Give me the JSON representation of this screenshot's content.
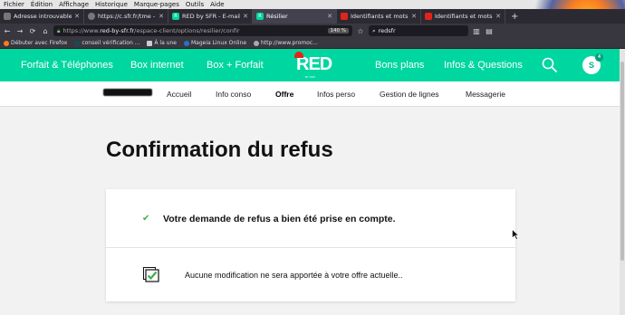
{
  "menubar": [
    "Fichier",
    "Édition",
    "Affichage",
    "Historique",
    "Marque-pages",
    "Outils",
    "Aide"
  ],
  "tabs": [
    {
      "title": "Adresse introuvable",
      "favicon_color": "#777777",
      "active": false
    },
    {
      "title": "https://c.sfr.fr/tme - Red",
      "favicon_color": "#777777",
      "active": false
    },
    {
      "title": "RED by SFR - E-mail",
      "favicon_color": "#00d6a0",
      "active": false
    },
    {
      "title": "Résilier",
      "favicon_color": "#00d6a0",
      "active": true
    },
    {
      "title": "Identifiants et mots de p",
      "favicon_color": "#e2231a",
      "active": false
    },
    {
      "title": "Identifiants et mots de p",
      "favicon_color": "#e2231a",
      "active": false
    }
  ],
  "navbar": {
    "url_prefix": "https://www.",
    "url_domain": "red-by-sfr.fr",
    "url_path": "/espace-client/options/resilier/confir",
    "zoom": "140 %",
    "search_value": "redsfr"
  },
  "bookmarks": [
    "Débuter avec Firefox",
    "conseil vérification ...",
    "À la une",
    "Mageia Linux Online",
    "http://www.promoc..."
  ],
  "site": {
    "nav_left": [
      "Forfait & Téléphones",
      "Box internet",
      "Box + Forfait"
    ],
    "logo": "RED",
    "logo_tag": "BY SFR",
    "nav_right": [
      "Bons plans",
      "Infos & Questions"
    ],
    "avatar_initial": "S",
    "avatar_badge": "4",
    "brand_color": "#00d6a0"
  },
  "subnav": {
    "items": [
      "Accueil",
      "Info conso",
      "Offre",
      "Infos perso",
      "Gestion de lignes",
      "Messagerie"
    ],
    "active": "Offre"
  },
  "main": {
    "title": "Confirmation du refus",
    "confirmation": "Votre demande de refus a bien été prise en compte.",
    "info": "Aucune modification ne sera apportée à votre offre actuelle.."
  }
}
